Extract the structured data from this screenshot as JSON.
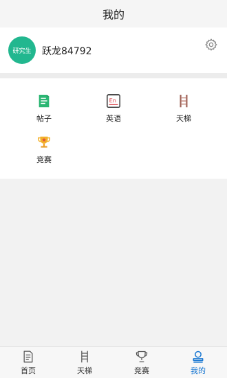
{
  "header": {
    "title": "我的"
  },
  "profile": {
    "avatar_text": "研究生",
    "username": "跃龙84792",
    "settings_icon": "gear-icon"
  },
  "grid": {
    "items": [
      {
        "label": "帖子",
        "icon": "post-icon"
      },
      {
        "label": "英语",
        "icon": "english-icon"
      },
      {
        "label": "天梯",
        "icon": "ladder-icon"
      },
      {
        "label": "竞赛",
        "icon": "trophy-icon"
      }
    ]
  },
  "tabbar": {
    "items": [
      {
        "label": "首页",
        "icon": "home-document-icon"
      },
      {
        "label": "天梯",
        "icon": "ladder-icon"
      },
      {
        "label": "竞赛",
        "icon": "trophy-icon"
      },
      {
        "label": "我的",
        "icon": "profile-icon",
        "active": true
      }
    ]
  },
  "colors": {
    "accent": "#1877d2",
    "avatar_bg": "#22b78f",
    "post_icon": "#2bb673",
    "english_icon": "#d9363e",
    "ladder_icon": "#a0655a",
    "trophy_icon": "#f0a020"
  }
}
